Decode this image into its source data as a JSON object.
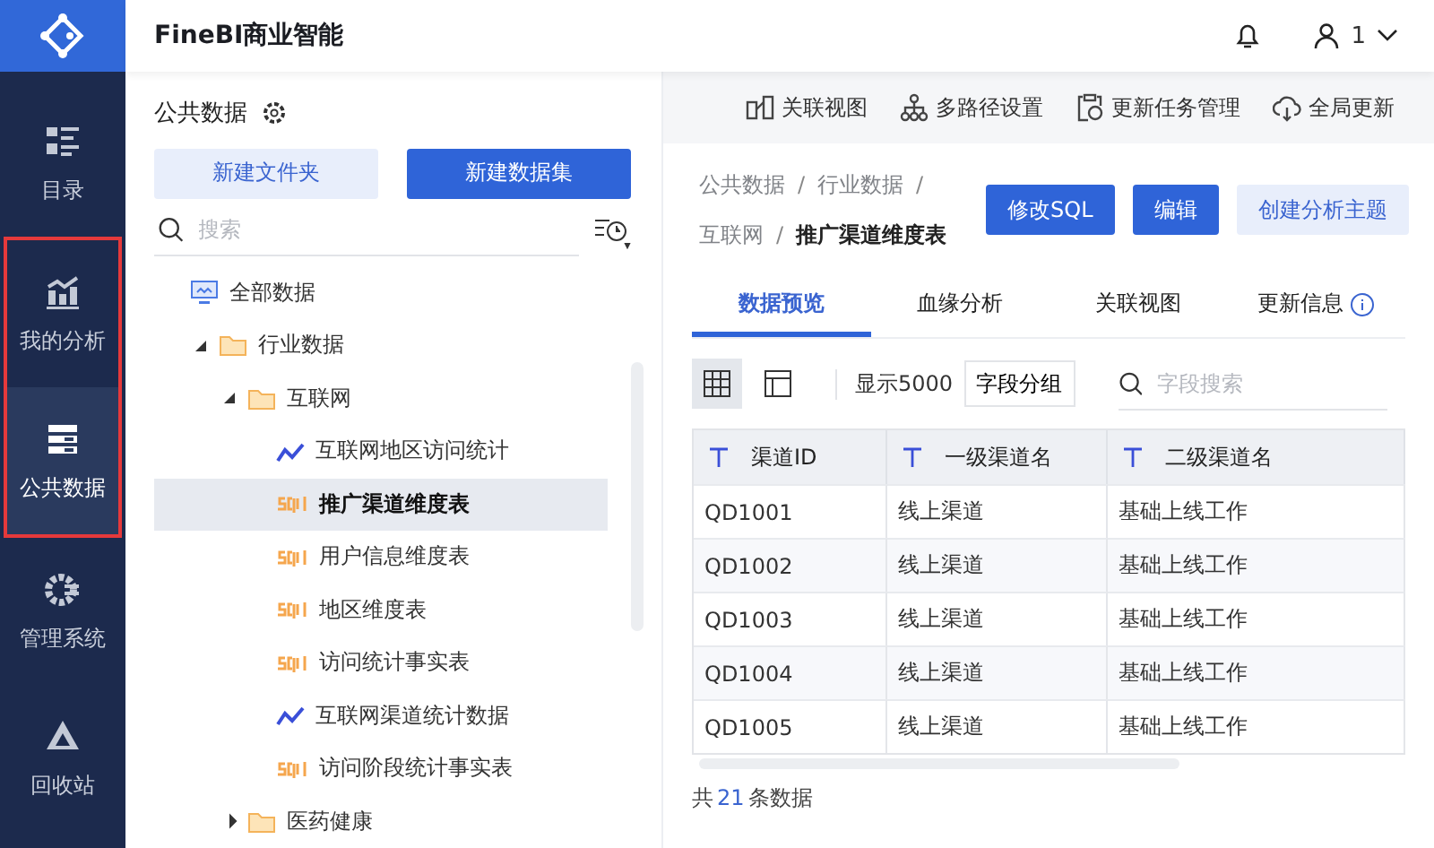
{
  "app": {
    "title": "FineBI商业智能"
  },
  "header": {
    "user": "1"
  },
  "nav": [
    {
      "label": "目录",
      "selected": false,
      "highlighted": false
    },
    {
      "label": "我的分析",
      "selected": false,
      "highlighted": true
    },
    {
      "label": "公共数据",
      "selected": true,
      "highlighted": true
    },
    {
      "label": "管理系统",
      "selected": false,
      "highlighted": false
    },
    {
      "label": "回收站",
      "selected": false,
      "highlighted": false
    }
  ],
  "panel": {
    "title": "公共数据",
    "buttons": [
      {
        "label": "新建文件夹",
        "kind": "secondary"
      },
      {
        "label": "新建数据集",
        "kind": "primary"
      }
    ],
    "search": {
      "placeholder": "搜索"
    }
  },
  "tree": [
    {
      "label": "全部数据",
      "kind": "root",
      "children": [
        {
          "label": "行业数据",
          "kind": "folder",
          "expanded": true,
          "children": [
            {
              "label": "互联网",
              "kind": "folder",
              "expanded": true,
              "children": [
                {
                  "label": "互联网地区访问统计",
                  "kind": "analysis",
                  "selected": false
                },
                {
                  "label": "推广渠道维度表",
                  "kind": "sql",
                  "selected": true
                },
                {
                  "label": "用户信息维度表",
                  "kind": "sql",
                  "selected": false
                },
                {
                  "label": "地区维度表",
                  "kind": "sql",
                  "selected": false
                },
                {
                  "label": "访问统计事实表",
                  "kind": "sql",
                  "selected": false
                },
                {
                  "label": "互联网渠道统计数据",
                  "kind": "analysis",
                  "selected": false
                },
                {
                  "label": "访问阶段统计事实表",
                  "kind": "sql",
                  "selected": false
                }
              ]
            },
            {
              "label": "医药健康",
              "kind": "folder",
              "expanded": false
            }
          ]
        }
      ]
    }
  ],
  "toolbar": [
    "关联视图",
    "多路径设置",
    "更新任务管理",
    "全局更新"
  ],
  "breadcrumb": [
    {
      "label": "公共数据",
      "current": false,
      "separator": "/"
    },
    {
      "label": "行业数据",
      "current": false,
      "separator": "/"
    },
    {
      "label": "互联网",
      "current": false,
      "separator": "/"
    },
    {
      "label": "推广渠道维度表",
      "current": true
    }
  ],
  "actions": [
    {
      "label": "修改SQL",
      "kind": "primary"
    },
    {
      "label": "编辑",
      "kind": "primary"
    },
    {
      "label": "创建分析主题",
      "kind": "secondary"
    }
  ],
  "tabs": [
    {
      "label": "数据预览",
      "selected": true
    },
    {
      "label": "血缘分析",
      "selected": false
    },
    {
      "label": "关联视图",
      "selected": false
    },
    {
      "label": "更新信息",
      "selected": false
    }
  ],
  "view_modes": [
    {
      "selected": true
    },
    {
      "selected": false
    }
  ],
  "rows_label": "显示5000",
  "group_button": "字段分组",
  "field_search": {
    "placeholder": "字段搜索"
  },
  "table": {
    "columns": [
      "渠道ID",
      "一级渠道名",
      "二级渠道名"
    ],
    "rows": [
      [
        "QD1001",
        "线上渠道",
        "基础上线工作"
      ],
      [
        "QD1002",
        "线上渠道",
        "基础上线工作"
      ],
      [
        "QD1003",
        "线上渠道",
        "基础上线工作"
      ],
      [
        "QD1004",
        "线上渠道",
        "基础上线工作"
      ],
      [
        "QD1005",
        "线上渠道",
        "基础上线工作"
      ]
    ]
  },
  "footer": {
    "prefix": "共",
    "count": "21",
    "suffix": "条数据"
  }
}
